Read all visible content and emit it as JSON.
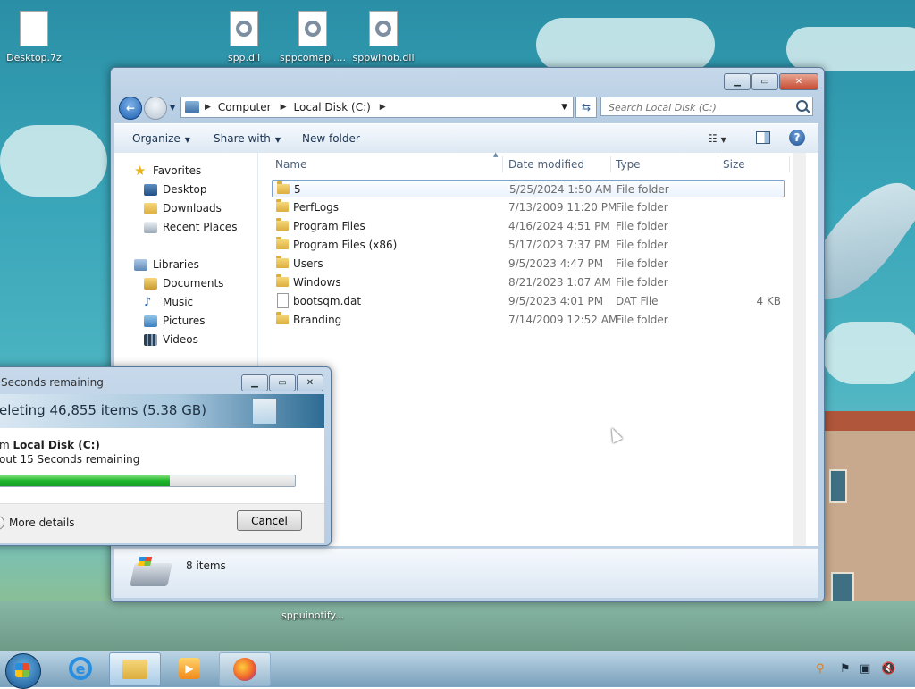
{
  "desktop": {
    "icons": [
      {
        "label": "Desktop.7z",
        "type": "file"
      },
      {
        "label": "spp.dll",
        "type": "dll"
      },
      {
        "label": "sppcomapi....",
        "type": "dll"
      },
      {
        "label": "sppwinob.dll",
        "type": "dll"
      },
      {
        "label": "sppuinotify...",
        "type": "dll"
      }
    ]
  },
  "explorer": {
    "breadcrumb": [
      "Computer",
      "Local Disk (C:)"
    ],
    "search_placeholder": "Search Local Disk (C:)",
    "toolbar": {
      "organize": "Organize",
      "share_with": "Share with",
      "new_folder": "New folder"
    },
    "nav": {
      "favorites_label": "Favorites",
      "favorites": [
        "Desktop",
        "Downloads",
        "Recent Places"
      ],
      "libraries_label": "Libraries",
      "libraries": [
        "Documents",
        "Music",
        "Pictures",
        "Videos"
      ]
    },
    "columns": [
      "Name",
      "Date modified",
      "Type",
      "Size"
    ],
    "files": [
      {
        "name": "5",
        "date": "5/25/2024 1:50 AM",
        "type": "File folder",
        "size": "",
        "kind": "folder",
        "selected": true
      },
      {
        "name": "PerfLogs",
        "date": "7/13/2009 11:20 PM",
        "type": "File folder",
        "size": "",
        "kind": "folder"
      },
      {
        "name": "Program Files",
        "date": "4/16/2024 4:51 PM",
        "type": "File folder",
        "size": "",
        "kind": "folder"
      },
      {
        "name": "Program Files (x86)",
        "date": "5/17/2023 7:37 PM",
        "type": "File folder",
        "size": "",
        "kind": "folder"
      },
      {
        "name": "Users",
        "date": "9/5/2023 4:47 PM",
        "type": "File folder",
        "size": "",
        "kind": "folder"
      },
      {
        "name": "Windows",
        "date": "8/21/2023 1:07 AM",
        "type": "File folder",
        "size": "",
        "kind": "folder"
      },
      {
        "name": "bootsqm.dat",
        "date": "9/5/2023 4:01 PM",
        "type": "DAT File",
        "size": "4 KB",
        "kind": "file"
      },
      {
        "name": "Branding",
        "date": "7/14/2009 12:52 AM",
        "type": "File folder",
        "size": "",
        "kind": "folder"
      }
    ],
    "status_count": "8 items"
  },
  "progress_dialog": {
    "title": "Seconds remaining",
    "banner": "eleting 46,855 items (5.38 GB)",
    "from_prefix": "m ",
    "from_location": "Local Disk (C:)",
    "remaining": "out 15 Seconds remaining",
    "progress": 0.58,
    "more_details": "More details",
    "cancel": "Cancel"
  },
  "colors": {
    "progress_fill": "#1db52a",
    "selection_border": "#7da2ce"
  }
}
